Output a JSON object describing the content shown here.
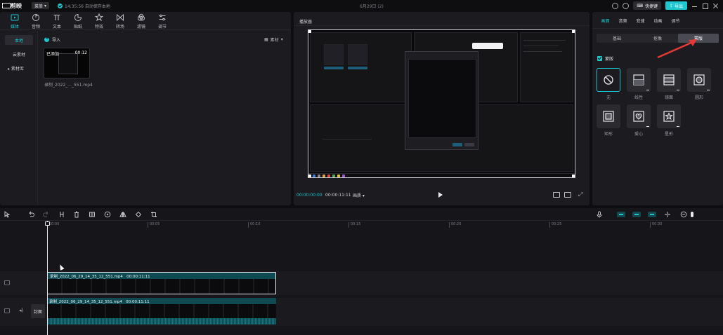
{
  "titlebar": {
    "app_name": "剪映",
    "menu_label": "菜单",
    "autosave_text": "14:35:56 自动保存本地",
    "doc_title": "6月29日 (2)",
    "shortcut_label": "快捷键",
    "export_label": "导出"
  },
  "media_tabs": [
    {
      "label": "媒体",
      "icon": "media-icon"
    },
    {
      "label": "音频",
      "icon": "audio-icon"
    },
    {
      "label": "文本",
      "icon": "text-icon"
    },
    {
      "label": "贴纸",
      "icon": "sticker-icon"
    },
    {
      "label": "特效",
      "icon": "effects-icon"
    },
    {
      "label": "转场",
      "icon": "transition-icon"
    },
    {
      "label": "滤镜",
      "icon": "filter-icon"
    },
    {
      "label": "调节",
      "icon": "adjust-icon"
    }
  ],
  "media_side": {
    "local": "本地",
    "cloud": "云素材",
    "library": "▸ 素材库"
  },
  "media": {
    "import_label": "导入",
    "sort_label": "素材",
    "thumb_added": "已添加",
    "thumb_duration": "00:12",
    "thumb_name": "录制_2022_..._551.mp4"
  },
  "player": {
    "title": "播放器",
    "time_current": "00:00:00:00",
    "time_total": "00:00:11:11",
    "quality": "画质 ▾"
  },
  "props": {
    "tabs": [
      "画面",
      "音频",
      "变速",
      "动画",
      "调节"
    ],
    "sub_tabs": [
      "基础",
      "抠像",
      "蒙版"
    ],
    "mask_label": "蒙版",
    "masks": [
      {
        "label": "无",
        "icon": "none-mask-icon"
      },
      {
        "label": "线性",
        "icon": "linear-mask-icon"
      },
      {
        "label": "镜面",
        "icon": "mirror-mask-icon"
      },
      {
        "label": "圆形",
        "icon": "circle-mask-icon"
      },
      {
        "label": "矩形",
        "icon": "rect-mask-icon"
      },
      {
        "label": "爱心",
        "icon": "heart-mask-icon"
      },
      {
        "label": "星形",
        "icon": "star-mask-icon"
      }
    ]
  },
  "timeline": {
    "ruler_labels": [
      "00:00",
      "00:05",
      "00:10",
      "00:15",
      "00:20",
      "00:25",
      "00:30"
    ],
    "clip_label": "录制_2022_06_29_14_35_12_551.mp4",
    "clip_duration": "00:00:11:11",
    "cover_label": "封面"
  },
  "colors": {
    "accent": "#1ec6cf",
    "panel": "#1c1c20",
    "background": "#0e0e10",
    "annotation": "#e53935"
  }
}
